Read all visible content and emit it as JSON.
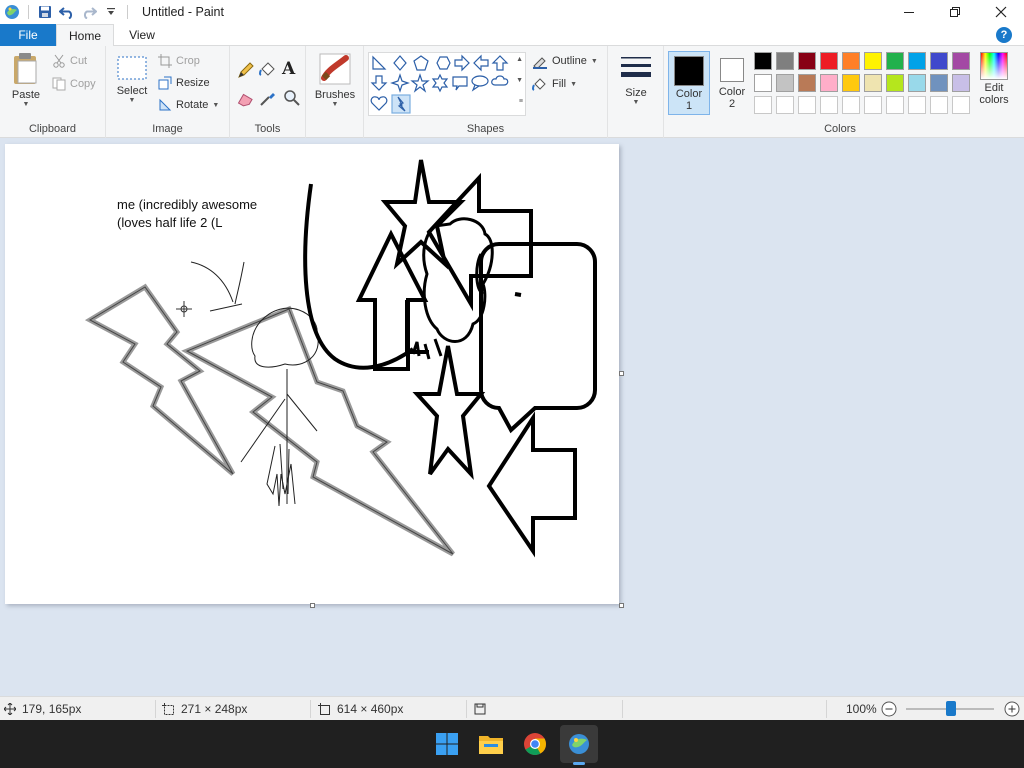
{
  "window": {
    "title": "Untitled - Paint"
  },
  "tabs": {
    "file": "File",
    "home": "Home",
    "view": "View",
    "help": "?"
  },
  "clipboard": {
    "paste": "Paste",
    "cut": "Cut",
    "copy": "Copy",
    "label": "Clipboard"
  },
  "image": {
    "select": "Select",
    "crop": "Crop",
    "resize": "Resize",
    "rotate": "Rotate",
    "label": "Image"
  },
  "tools": {
    "label": "Tools"
  },
  "brushes": {
    "label": "Brushes"
  },
  "shapes": {
    "outline": "Outline",
    "fill": "Fill",
    "label": "Shapes"
  },
  "size": {
    "label": "Size"
  },
  "colors": {
    "color1": "Color",
    "color1_num": "1",
    "color2": "Color",
    "color2_num": "2",
    "edit1": "Edit",
    "edit2": "colors",
    "label": "Colors",
    "color1_value": "#000000",
    "color2_value": "#ffffff",
    "palette_row1": [
      "#000000",
      "#7f7f7f",
      "#880015",
      "#ed1c24",
      "#ff7f27",
      "#fff200",
      "#22b14c",
      "#00a2e8",
      "#3f48cc",
      "#a349a4"
    ],
    "palette_row2": [
      "#ffffff",
      "#c3c3c3",
      "#b97a57",
      "#ffaec9",
      "#ffc90e",
      "#efe4b0",
      "#b5e61d",
      "#99d9ea",
      "#7092be",
      "#c8bfe7"
    ],
    "palette_row3": [
      "#ffffff",
      "#ffffff",
      "#ffffff",
      "#ffffff",
      "#ffffff",
      "#ffffff",
      "#ffffff",
      "#ffffff",
      "#ffffff",
      "#ffffff"
    ]
  },
  "canvas": {
    "text_line1": "me (incredibly awesome",
    "text_line2": "(loves half life 2 (L"
  },
  "status": {
    "cursor": "179, 165px",
    "selection": "271 × 248px",
    "canvas_size": "614 × 460px",
    "zoom": "100%"
  },
  "icons": {
    "app": "paint-app-icon",
    "save": "save-icon",
    "undo": "undo-icon",
    "redo": "redo-icon",
    "pencil": "pencil-icon",
    "fill": "fill-bucket-icon",
    "text": "text-icon",
    "eraser": "eraser-icon",
    "picker": "color-picker-icon",
    "magnifier": "magnifier-icon",
    "windows": "windows-start-icon",
    "explorer": "file-explorer-icon",
    "chrome": "chrome-icon"
  }
}
